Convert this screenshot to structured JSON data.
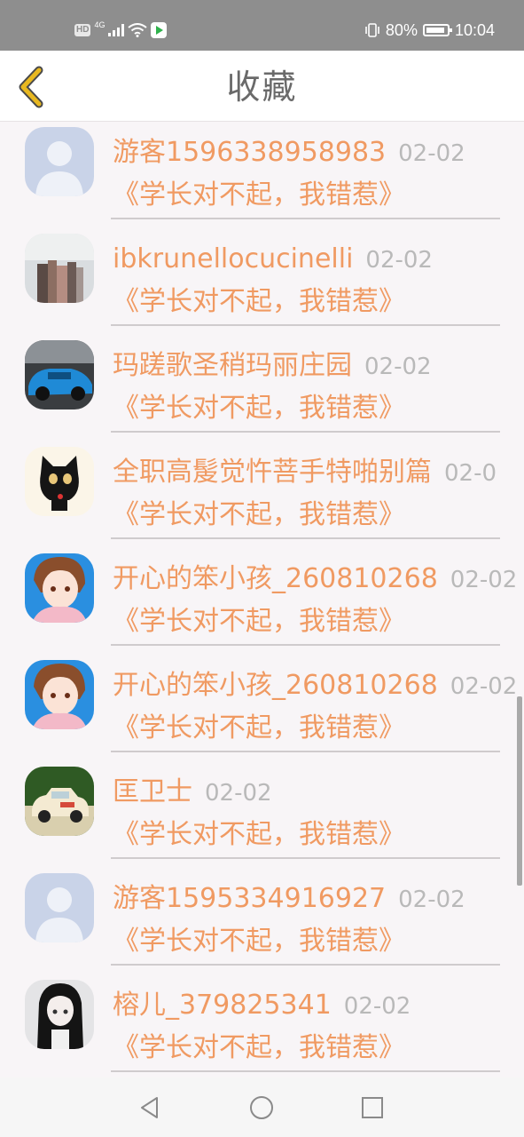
{
  "status_bar": {
    "hd": "HD",
    "network": "4G",
    "battery_percent": "80%",
    "time": "10:04"
  },
  "header": {
    "title": "收藏",
    "back_icon": "chevron-left-icon",
    "accent": "#e8b820"
  },
  "colors": {
    "name": "#f09a62",
    "date": "#b9b9b9",
    "background": "#f8f5f7"
  },
  "items": [
    {
      "name": "游客1596338958983",
      "date": "02-02",
      "title": "《学长对不起，我错惹》",
      "avatar": "default-avatar"
    },
    {
      "name": "ibkrunellocucinelli",
      "date": "02-02",
      "title": "《学长对不起，我错惹》",
      "avatar": "books-avatar"
    },
    {
      "name": "玛蹉歌圣稍玛丽庄园",
      "date": "02-02",
      "title": "《学长对不起，我错惹》",
      "avatar": "car-avatar"
    },
    {
      "name": "全职高髲觉忤菩手特啪别篇",
      "date": "02-0",
      "title": "《学长对不起，我错惹》",
      "avatar": "cat-avatar"
    },
    {
      "name": "开心的笨小孩_260810268",
      "date": "02-02",
      "title": "《学长对不起，我错惹》",
      "avatar": "anime-avatar"
    },
    {
      "name": "开心的笨小孩_260810268",
      "date": "02-02",
      "title": "《学长对不起，我错惹》",
      "avatar": "anime-avatar"
    },
    {
      "name": "匡卫士",
      "date": "02-02",
      "title": "《学长对不起，我错惹》",
      "avatar": "toy-car-avatar"
    },
    {
      "name": "游客1595334916927",
      "date": "02-02",
      "title": "《学长对不起，我错惹》",
      "avatar": "default-avatar"
    },
    {
      "name": "榕儿_379825341",
      "date": "02-02",
      "title": "《学长对不起，我错惹》",
      "avatar": "girl-avatar"
    }
  ],
  "system_nav": {
    "back": "back-triangle-icon",
    "home": "home-circle-icon",
    "recents": "recents-square-icon"
  }
}
